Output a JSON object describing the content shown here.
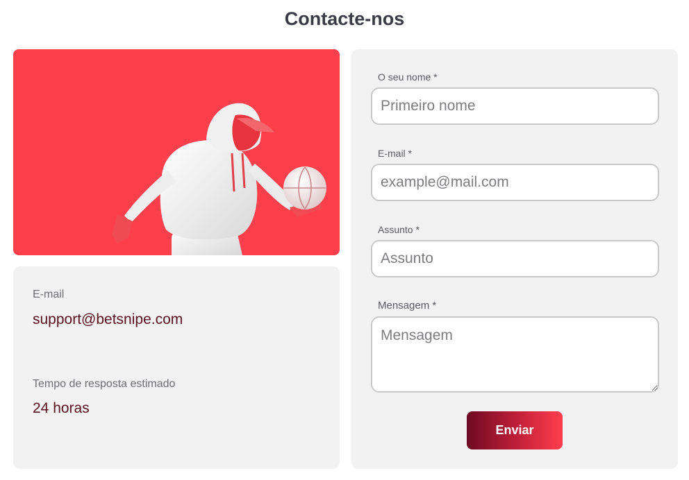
{
  "page": {
    "title": "Contacte-nos"
  },
  "colors": {
    "hero_background": "#fd3e4b",
    "card_background": "#f2f2f2",
    "accent_text": "#5a1020",
    "button_gradient_start": "#6e0a22",
    "button_gradient_end": "#ff3e4d"
  },
  "hero": {
    "image_description_icon": "basketball-player-illustration"
  },
  "info": {
    "email_label": "E-mail",
    "email_value": "support@betsnipe.com",
    "response_label": "Tempo de resposta estimado",
    "response_value": "24 horas"
  },
  "form": {
    "name_label": "O seu nome *",
    "name_placeholder": "Primeiro nome",
    "email_label": "E-mail *",
    "email_placeholder": "example@mail.com",
    "subject_label": "Assunto *",
    "subject_placeholder": "Assunto",
    "message_label": "Mensagem *",
    "message_placeholder": "Mensagem",
    "submit_label": "Enviar"
  }
}
